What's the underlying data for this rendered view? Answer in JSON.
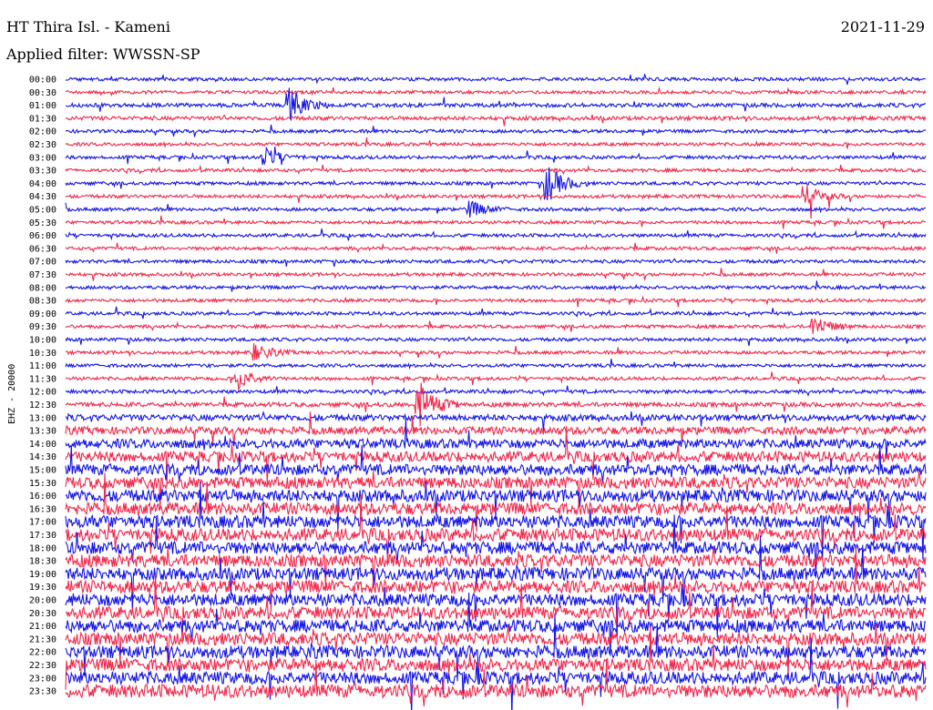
{
  "header": {
    "station": "HT Thira Isl. - Kameni",
    "date": "2021-11-29",
    "filter_text": "Applied filter: WWSSN-SP"
  },
  "colors": {
    "trace_a": "#1414e6",
    "trace_b": "#f0284b",
    "background": "#ffffff",
    "text": "#000000"
  },
  "chart_data": {
    "type": "line",
    "title": "HT Thira Isl. - Kameni",
    "ylabel": "EHZ - 20000",
    "xlabel": "",
    "row_labels": [
      "00:00",
      "00:30",
      "01:00",
      "01:30",
      "02:00",
      "02:30",
      "03:00",
      "03:30",
      "04:00",
      "04:30",
      "05:00",
      "05:30",
      "06:00",
      "06:30",
      "07:00",
      "07:30",
      "08:00",
      "08:30",
      "09:00",
      "09:30",
      "10:00",
      "10:30",
      "11:00",
      "11:30",
      "12:00",
      "12:30",
      "13:00",
      "13:30",
      "14:00",
      "14:30",
      "15:00",
      "15:30",
      "16:00",
      "16:30",
      "17:00",
      "17:30",
      "18:00",
      "18:30",
      "19:00",
      "19:30",
      "20:00",
      "20:30",
      "21:00",
      "21:30",
      "22:00",
      "22:30",
      "23:00",
      "23:30"
    ],
    "row_colors": [
      "blue",
      "red"
    ],
    "noise_level": [
      0.3,
      0.3,
      0.35,
      0.35,
      0.3,
      0.3,
      0.3,
      0.3,
      0.3,
      0.3,
      0.3,
      0.3,
      0.3,
      0.3,
      0.3,
      0.3,
      0.3,
      0.3,
      0.3,
      0.3,
      0.3,
      0.3,
      0.3,
      0.3,
      0.32,
      0.4,
      0.55,
      0.7,
      0.85,
      0.95,
      1.0,
      1.05,
      1.1,
      1.1,
      1.15,
      1.15,
      1.15,
      1.15,
      1.15,
      1.15,
      1.15,
      1.15,
      1.15,
      1.15,
      1.15,
      1.15,
      1.15,
      1.2
    ],
    "events": [
      {
        "row": 2,
        "t": 0.26,
        "amp": 3.0
      },
      {
        "row": 6,
        "t": 0.23,
        "amp": 2.0
      },
      {
        "row": 8,
        "t": 0.56,
        "amp": 3.5
      },
      {
        "row": 9,
        "t": 0.86,
        "amp": 2.0
      },
      {
        "row": 10,
        "t": 0.47,
        "amp": 1.5
      },
      {
        "row": 19,
        "t": 0.87,
        "amp": 2.0
      },
      {
        "row": 21,
        "t": 0.22,
        "amp": 1.6
      },
      {
        "row": 23,
        "t": 0.2,
        "amp": 2.2
      },
      {
        "row": 25,
        "t": 0.41,
        "amp": 4.5
      }
    ]
  }
}
